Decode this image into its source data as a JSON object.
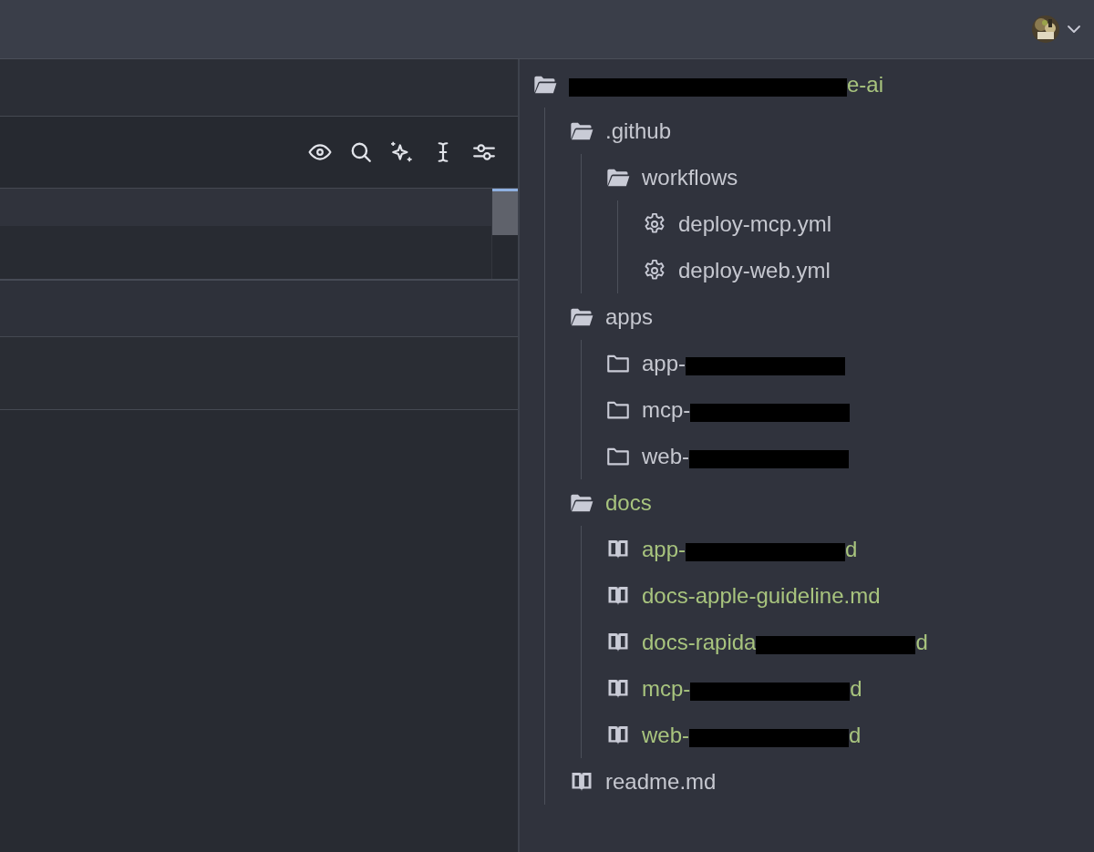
{
  "file_tree": {
    "root": {
      "kind": "folder",
      "expanded": true,
      "added": true,
      "redacted": true,
      "text_after": "e-ai",
      "children": [
        {
          "kind": "folder",
          "expanded": true,
          "added": false,
          "text_before": ".github",
          "children": [
            {
              "kind": "folder",
              "expanded": true,
              "added": false,
              "text_before": "workflows",
              "children": [
                {
                  "kind": "config",
                  "added": false,
                  "text_before": "deploy-mcp.yml"
                },
                {
                  "kind": "config",
                  "added": false,
                  "text_before": "deploy-web.yml"
                }
              ]
            }
          ]
        },
        {
          "kind": "folder",
          "expanded": true,
          "added": false,
          "text_before": "apps",
          "children": [
            {
              "kind": "folder",
              "expanded": false,
              "added": false,
              "text_before": "app-",
              "redacted": true
            },
            {
              "kind": "folder",
              "expanded": false,
              "added": false,
              "text_before": "mcp-",
              "redacted": true
            },
            {
              "kind": "folder",
              "expanded": false,
              "added": false,
              "text_before": "web-",
              "redacted": true
            }
          ]
        },
        {
          "kind": "folder",
          "expanded": true,
          "added": true,
          "text_before": "docs",
          "children": [
            {
              "kind": "doc",
              "added": true,
              "text_before": "app-",
              "redacted": true,
              "text_after": "d"
            },
            {
              "kind": "doc",
              "added": true,
              "text_before": "docs-apple-guideline.md"
            },
            {
              "kind": "doc",
              "added": true,
              "text_before": "docs-rapida",
              "redacted": true,
              "text_after": "d"
            },
            {
              "kind": "doc",
              "added": true,
              "text_before": "mcp-",
              "redacted": true,
              "text_after": "d"
            },
            {
              "kind": "doc",
              "added": true,
              "text_before": "web-",
              "redacted": true,
              "text_after": "d"
            }
          ]
        },
        {
          "kind": "doc",
          "added": false,
          "text_before": "readme.md"
        }
      ]
    }
  }
}
